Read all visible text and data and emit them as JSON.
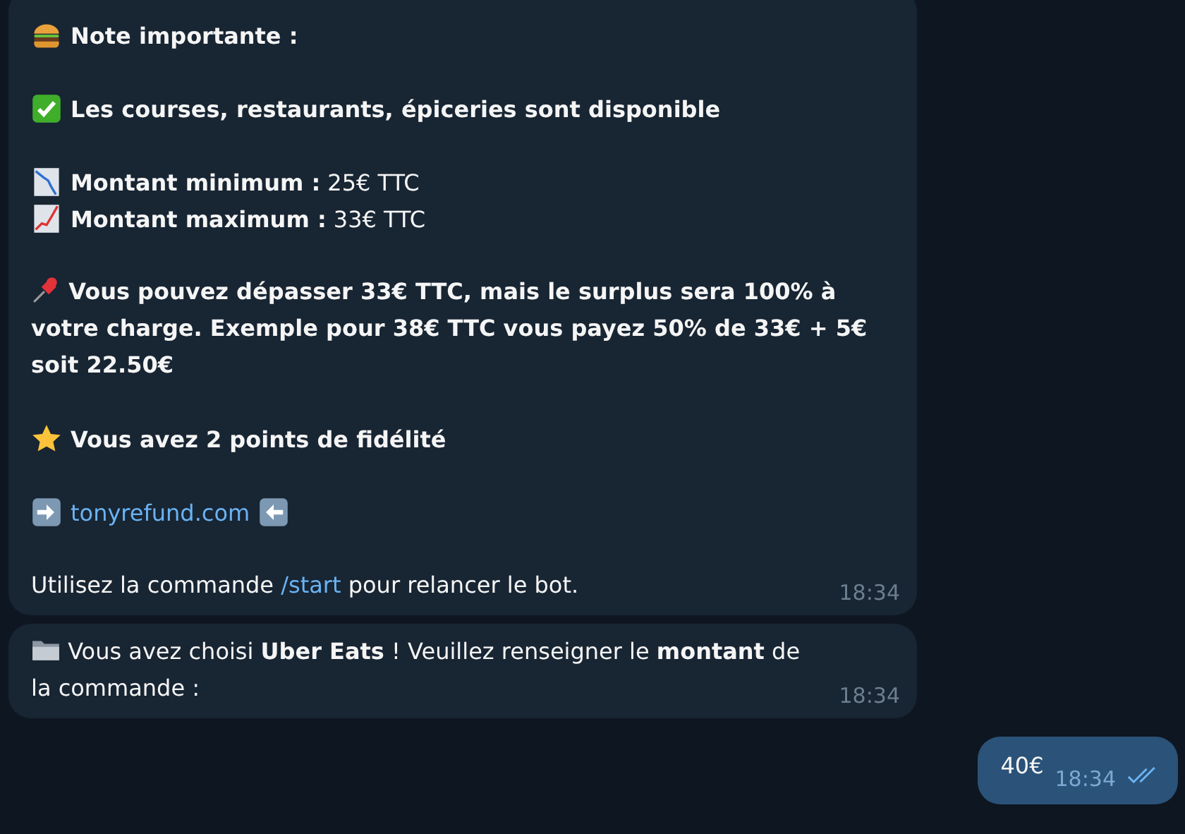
{
  "messages": [
    {
      "kind": "note",
      "title": "Note importante :",
      "availability": "Les courses, restaurants, épiceries sont disponible",
      "minimum": {
        "label": "Montant minimum :",
        "value": "25€ TTC"
      },
      "maximum": {
        "label": "Montant maximum :",
        "value": "33€ TTC"
      },
      "surplus": "Vous pouvez dépasser 33€ TTC, mais le surplus sera 100% à votre charge. Exemple pour 38€ TTC vous payez 50% de 33€ + 5€ soit 22.50€",
      "loyalty": "Vous avez 2 points de fidélité",
      "link": "tonyrefund.com",
      "footer": {
        "before": "Utilisez la commande",
        "command": "/start",
        "after": "pour relancer le bot."
      },
      "time": "18:34"
    },
    {
      "kind": "prompt",
      "text": "Vous avez choisi **Uber Eats** ! Veuillez renseigner le **montant** de la commande :",
      "time": "18:34"
    },
    {
      "kind": "outgoing",
      "text": "40€",
      "time": "18:34",
      "read": true
    }
  ]
}
